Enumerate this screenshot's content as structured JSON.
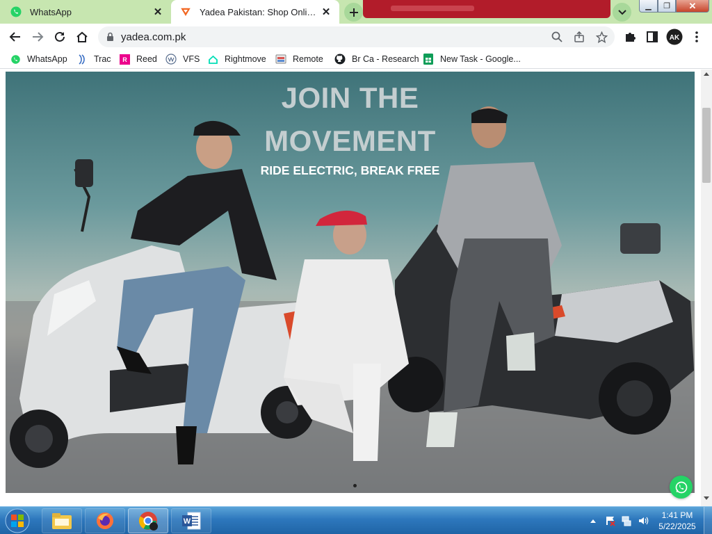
{
  "browser": {
    "tabs": [
      {
        "title": "WhatsApp",
        "favicon": "whatsapp-icon",
        "active": false
      },
      {
        "title": "Yadea Pakistan: Shop Online EV E",
        "favicon": "yadea-icon",
        "active": true
      }
    ],
    "address": {
      "url": "yadea.com.pk"
    },
    "bookmarks": [
      {
        "label": "WhatsApp",
        "icon": "whatsapp-icon"
      },
      {
        "label": "Trac",
        "icon": "trac-icon"
      },
      {
        "label": "Reed",
        "icon": "reed-icon"
      },
      {
        "label": "VFS",
        "icon": "vfs-icon"
      },
      {
        "label": "Rightmove",
        "icon": "rightmove-icon"
      },
      {
        "label": "Remote",
        "icon": "remote-icon"
      },
      {
        "label": "Br Ca - Research",
        "icon": "github-icon"
      },
      {
        "label": "New Task - Google...",
        "icon": "google-sheets-icon"
      }
    ],
    "profile_initials": "AK"
  },
  "hero": {
    "title_line1": "JOIN THE",
    "title_line2": "MOVEMENT",
    "subtitle": "RIDE ELECTRIC, BREAK FREE"
  },
  "taskbar": {
    "apps": [
      "explorer-icon",
      "firefox-icon",
      "chrome-icon",
      "word-icon"
    ],
    "clock": {
      "time": "1:41 PM",
      "date": "5/22/2025"
    }
  },
  "colors": {
    "tabstrip": "#c7e6b0",
    "whatsapp": "#25d366",
    "yadea_brand": "#f26722"
  }
}
